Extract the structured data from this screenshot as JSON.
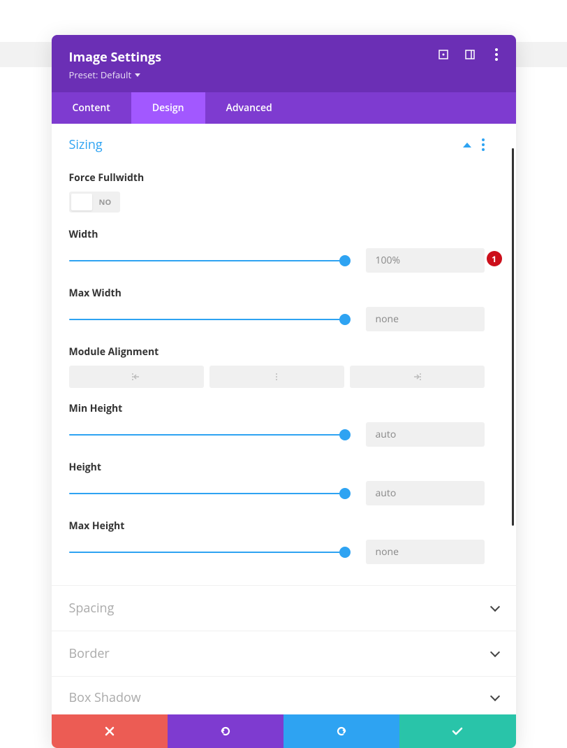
{
  "header": {
    "title": "Image Settings",
    "preset_label": "Preset: Default"
  },
  "tabs": {
    "content": "Content",
    "design": "Design",
    "advanced": "Advanced"
  },
  "sizing": {
    "title": "Sizing",
    "force_fullwidth": {
      "label": "Force Fullwidth",
      "value": "NO"
    },
    "width": {
      "label": "Width",
      "value": "100%",
      "badge": "1",
      "percent": 100
    },
    "max_width": {
      "label": "Max Width",
      "value": "none",
      "percent": 100
    },
    "module_alignment": {
      "label": "Module Alignment"
    },
    "min_height": {
      "label": "Min Height",
      "value": "auto",
      "percent": 100
    },
    "height": {
      "label": "Height",
      "value": "auto",
      "percent": 100
    },
    "max_height": {
      "label": "Max Height",
      "value": "none",
      "percent": 100
    }
  },
  "sections": {
    "spacing": "Spacing",
    "border": "Border",
    "box_shadow": "Box Shadow"
  }
}
